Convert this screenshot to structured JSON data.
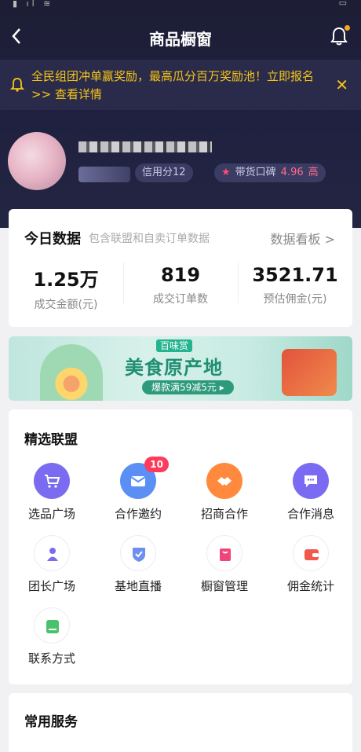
{
  "nav": {
    "title": "商品橱窗"
  },
  "notice": {
    "text": "全民组团冲单赢奖励，最高瓜分百万奖励池！立即报名 >> 查看详情",
    "close": "✕"
  },
  "profile": {
    "credit": "信用分12",
    "koubei_label": "带货口碑",
    "koubei_score": "4.96",
    "koubei_level": "高"
  },
  "today": {
    "title": "今日数据",
    "subtitle": "包含联盟和自卖订单数据",
    "link": "数据看板 >",
    "stats": [
      {
        "value": "1.25万",
        "label": "成交金额(元)"
      },
      {
        "value": "819",
        "label": "成交订单数"
      },
      {
        "value": "3521.71",
        "label": "预估佣金(元)"
      }
    ]
  },
  "banner": {
    "brand": "百味赏",
    "headline": "美食原产地",
    "chip": "爆款满59减5元 ▸"
  },
  "alliance": {
    "title": "精选联盟",
    "items": [
      {
        "label": "选品广场",
        "icon": "cart-icon"
      },
      {
        "label": "合作邀约",
        "icon": "mail-icon",
        "badge": "10"
      },
      {
        "label": "招商合作",
        "icon": "handshake-icon"
      },
      {
        "label": "合作消息",
        "icon": "chat-icon"
      },
      {
        "label": "团长广场",
        "icon": "person-icon"
      },
      {
        "label": "基地直播",
        "icon": "shield-icon"
      },
      {
        "label": "橱窗管理",
        "icon": "bag-icon"
      },
      {
        "label": "佣金统计",
        "icon": "wallet-icon"
      },
      {
        "label": "联系方式",
        "icon": "phone-icon"
      }
    ]
  },
  "services": {
    "title": "常用服务"
  },
  "colors": {
    "accent": "#f5c518",
    "badge": "#ff3b5c",
    "hero_bg": "#1f2140"
  }
}
